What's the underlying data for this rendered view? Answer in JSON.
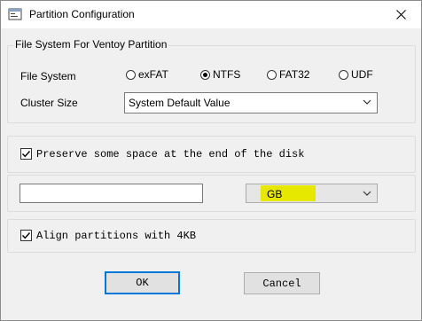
{
  "window": {
    "title": "Partition Configuration"
  },
  "fs_group": {
    "label": "File System For Ventoy Partition",
    "file_system_label": "File System",
    "options": [
      "exFAT",
      "NTFS",
      "FAT32",
      "UDF"
    ],
    "selected": "NTFS",
    "cluster_size_label": "Cluster Size",
    "cluster_size_value": "System Default Value"
  },
  "preserve": {
    "checked": true,
    "label": "Preserve some space at the end of the disk",
    "size_value": "",
    "unit_value": "GB",
    "unit_highlight": "#e6e800"
  },
  "align": {
    "checked": true,
    "label": "Align partitions with 4KB"
  },
  "buttons": {
    "ok": "OK",
    "cancel": "Cancel"
  }
}
